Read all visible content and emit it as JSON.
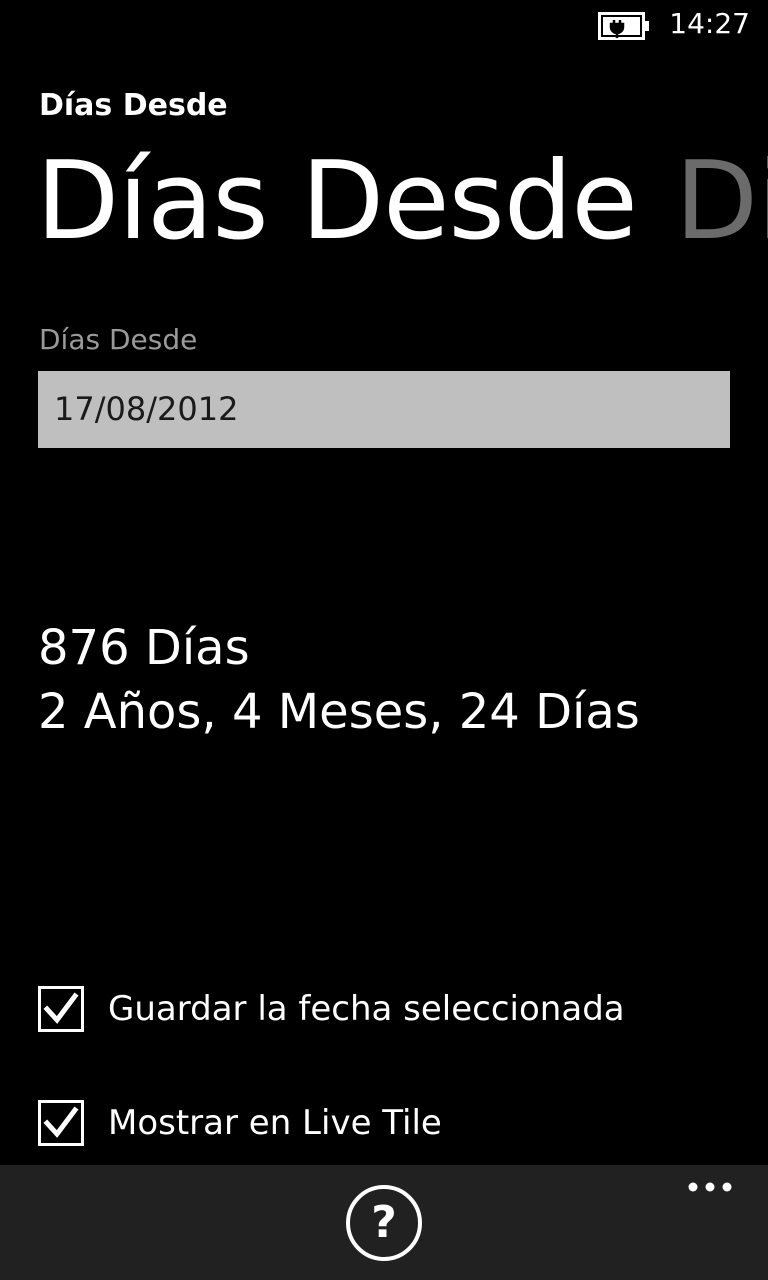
{
  "status_bar": {
    "time": "14:27",
    "battery_icon": "battery-charging-icon"
  },
  "app": {
    "title": "Días Desde"
  },
  "pivot": {
    "active": "Días Desde",
    "next": "Dife"
  },
  "form": {
    "field_label": "Días Desde",
    "date_value": "17/08/2012"
  },
  "result": {
    "days": "876 Días",
    "breakdown": "2 Años, 4 Meses, 24 Días"
  },
  "options": [
    {
      "label": "Guardar la fecha seleccionada",
      "checked": true
    },
    {
      "label": "Mostrar en Live Tile",
      "checked": true
    }
  ],
  "app_bar": {
    "help_glyph": "?",
    "help_icon": "help-icon",
    "more_icon": "more-dots-icon",
    "background": "#212121"
  }
}
